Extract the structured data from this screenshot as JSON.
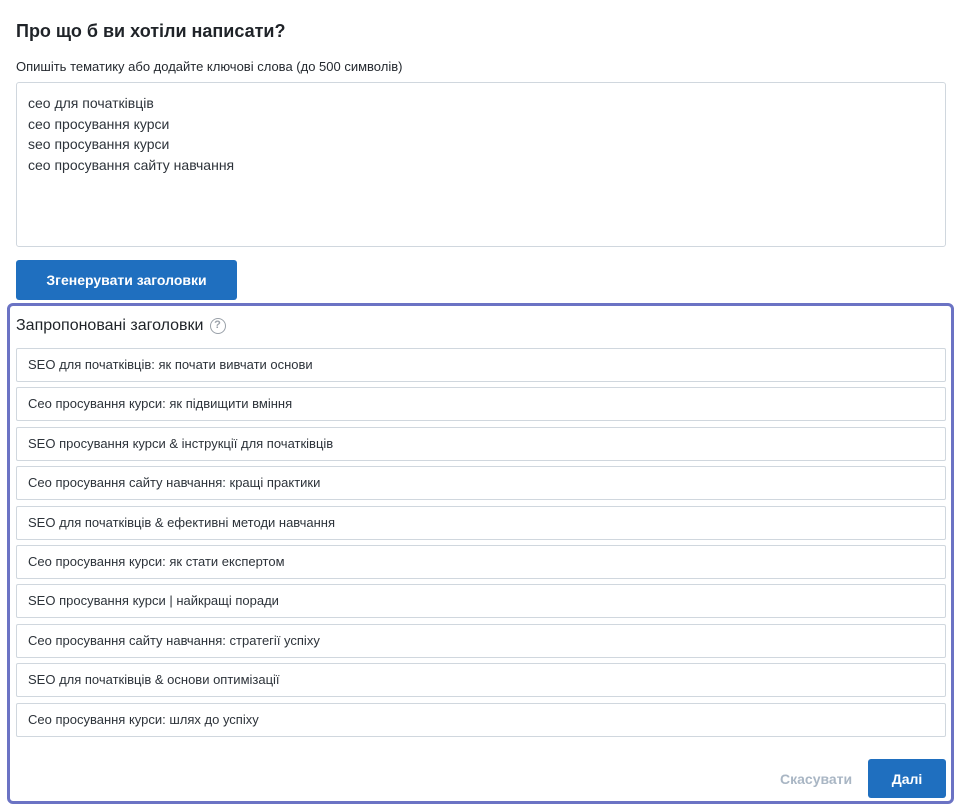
{
  "form": {
    "heading": "Про що б ви хотіли написати?",
    "description": "Опишіть тематику або додайте ключові слова (до 500 символів)",
    "topic_value": "сео для початківців\nсео просування курси\nseo просування курси\nсео просування сайту навчання",
    "generate_label": "Згенерувати заголовки"
  },
  "suggestions": {
    "title": "Запропоновані заголовки",
    "help_icon": "?",
    "items": [
      "SEO для початківців: як почати вивчати основи",
      "Сео просування курси: як підвищити вміння",
      "SEO просування курси & інструкції для початківців",
      "Сео просування сайту навчання: кращі практики",
      "SEO для початківців & ефективні методи навчання",
      "Сео просування курси: як стати експертом",
      "SEO просування курси | найкращі поради",
      "Сео просування сайту навчання: стратегії успіху",
      "SEO для початківців & основи оптимізації",
      "Сео просування курси: шлях до успіху"
    ]
  },
  "actions": {
    "cancel_label": "Скасувати",
    "next_label": "Далі"
  },
  "colors": {
    "accent": "#1f6fbf",
    "panel_border": "#6b73c4",
    "muted": "#a9b6c4"
  }
}
